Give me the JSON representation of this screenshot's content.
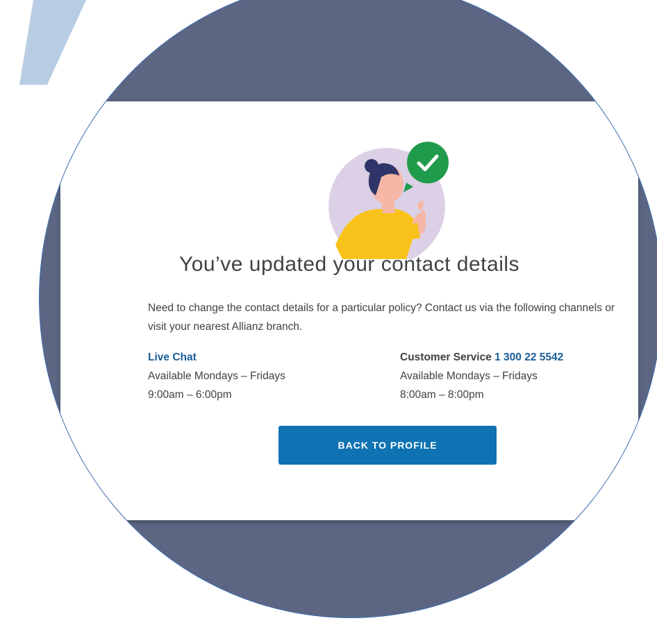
{
  "confirmation": {
    "title": "You’ve updated your contact details",
    "intro": "Need to change the contact details for a particular policy? Contact us via the following channels or visit your nearest Allianz branch."
  },
  "contact": {
    "live_chat": {
      "label": "Live Chat",
      "availability": "Available Mondays – Fridays",
      "hours": "9:00am – 6:00pm"
    },
    "customer_service": {
      "label": "Customer Service",
      "phone": "1 300 22 5542",
      "availability": "Available Mondays – Fridays",
      "hours": "8:00am – 8:00pm"
    }
  },
  "actions": {
    "back_label": "BACK TO PROFILE"
  },
  "icons": {
    "hero": "person-thumbs-up-illustration",
    "badge": "checkmark-icon"
  },
  "colors": {
    "circle_background": "#5c6683",
    "primary_button": "#0f73b3",
    "link": "#1a5e98",
    "check_badge": "#1f9b4b",
    "slash": "#b8cde4"
  }
}
